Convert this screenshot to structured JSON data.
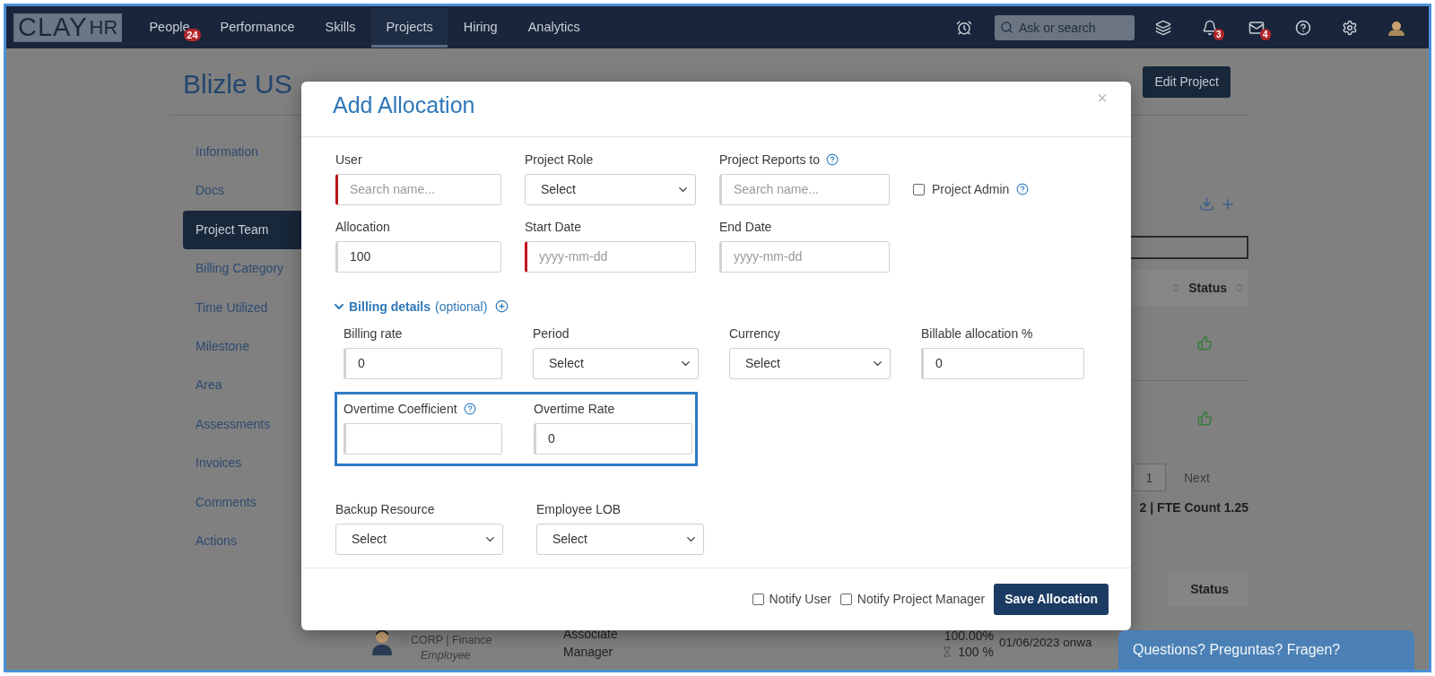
{
  "nav": {
    "logo": {
      "main": "CLAY",
      "suffix": "HR"
    },
    "items": [
      {
        "label": "People",
        "selected": false,
        "badge": "24"
      },
      {
        "label": "Performance",
        "selected": false
      },
      {
        "label": "Skills",
        "selected": false
      },
      {
        "label": "Projects",
        "selected": true
      },
      {
        "label": "Hiring",
        "selected": false
      },
      {
        "label": "Analytics",
        "selected": false
      }
    ],
    "tools": [
      {
        "kind": "alarm"
      },
      {
        "kind": "search",
        "placeholder": "Ask or search"
      },
      {
        "kind": "layers"
      },
      {
        "kind": "bell",
        "badge": "3"
      },
      {
        "kind": "mail",
        "badge": "4"
      },
      {
        "kind": "help"
      },
      {
        "kind": "settings"
      },
      {
        "kind": "avatar"
      }
    ]
  },
  "project": {
    "title": "Blizle US",
    "edit_button": "Edit Project"
  },
  "sidebar": {
    "items": [
      {
        "label": "Information",
        "selected": false
      },
      {
        "label": "Docs",
        "selected": false
      },
      {
        "label": "Project Team",
        "selected": true
      },
      {
        "label": "Billing Category",
        "selected": false
      },
      {
        "label": "Time Utilized",
        "selected": false
      },
      {
        "label": "Milestone",
        "selected": false
      },
      {
        "label": "Area",
        "selected": false
      },
      {
        "label": "Assessments",
        "selected": false
      },
      {
        "label": "Invoices",
        "selected": false
      },
      {
        "label": "Comments",
        "selected": false
      },
      {
        "label": "Actions",
        "selected": false
      }
    ]
  },
  "team_panel": {
    "header": "Status",
    "rows": [
      {
        "kind": "approved"
      },
      {
        "kind": "approved"
      }
    ],
    "pagination": {
      "page": "1",
      "next": "Next"
    },
    "summary": "2 | FTE Count 1.25"
  },
  "allocations": {
    "header": "Status",
    "rows": [
      {
        "org": "CORP | Finance",
        "type": "Employee",
        "role": "Associate Manager",
        "allocation": "100.00%",
        "billable": "100 %",
        "dates": "01/06/2023 onwa"
      }
    ]
  },
  "modal": {
    "title": "Add Allocation",
    "close": "×",
    "rows": [
      [
        {
          "kind": "text",
          "label": "User",
          "placeholder": "Search name...",
          "required": true
        },
        {
          "kind": "select",
          "label": "Project Role",
          "value": "Select"
        },
        {
          "kind": "text",
          "label": "Project Reports to",
          "help": true,
          "placeholder": "Search name...",
          "required": false
        },
        {
          "kind": "checkbox",
          "label": "Project Admin",
          "checked": false,
          "help": true
        }
      ],
      [
        {
          "kind": "text",
          "label": "Allocation",
          "value": "100",
          "required": false
        },
        {
          "kind": "text",
          "label": "Start Date",
          "placeholder": "yyyy-mm-dd",
          "required": true
        },
        {
          "kind": "text",
          "label": "End Date",
          "placeholder": "yyyy-mm-dd",
          "required": false
        }
      ]
    ],
    "billing": {
      "label": "Billing details",
      "hint": "(optional)",
      "expanded": true,
      "fields": [
        {
          "kind": "text",
          "label": "Billing rate",
          "value": "0",
          "required": false
        },
        {
          "kind": "select",
          "label": "Period",
          "value": "Select"
        },
        {
          "kind": "select",
          "label": "Currency",
          "value": "Select"
        },
        {
          "kind": "text",
          "label": "Billable allocation %",
          "value": "0",
          "required": false
        }
      ],
      "overtime": {
        "highlighted": true,
        "fields": [
          {
            "kind": "text",
            "label": "Overtime Coefficient",
            "help": true,
            "required": false
          },
          {
            "kind": "text",
            "label": "Overtime Rate",
            "value": "0",
            "required": false
          }
        ]
      }
    },
    "extra": [
      {
        "kind": "select",
        "label": "Backup Resource",
        "value": "Select"
      },
      {
        "kind": "select",
        "label": "Employee LOB",
        "value": "Select"
      }
    ],
    "footer": {
      "options": [
        {
          "label": "Notify User",
          "checked": false
        },
        {
          "label": "Notify Project Manager",
          "checked": false
        }
      ],
      "submit": "Save Allocation"
    }
  },
  "chat": {
    "label": "Questions? Preguntas? Fragen?"
  }
}
